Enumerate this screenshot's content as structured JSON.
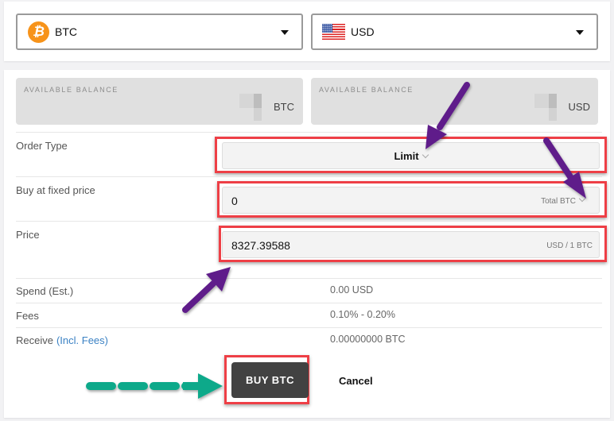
{
  "currency_selectors": {
    "crypto": {
      "label": "BTC",
      "icon": "bitcoin-icon"
    },
    "fiat": {
      "label": "USD",
      "icon": "us-flag-icon"
    }
  },
  "balances": [
    {
      "label": "AVAILABLE BALANCE",
      "currency": "BTC"
    },
    {
      "label": "AVAILABLE BALANCE",
      "currency": "USD"
    }
  ],
  "order_form": {
    "order_type": {
      "label": "Order Type",
      "value": "Limit"
    },
    "amount": {
      "label": "Buy at fixed price",
      "value": "0",
      "unit": "Total BTC"
    },
    "price": {
      "label": "Price",
      "value": "8327.39588",
      "unit": "USD / 1 BTC"
    }
  },
  "summary": {
    "spend": {
      "label": "Spend (Est.)",
      "value": "0.00 USD"
    },
    "fees": {
      "label": "Fees",
      "value": "0.10% - 0.20%"
    },
    "receive": {
      "label": "Receive",
      "link": "(Incl. Fees)",
      "value": "0.00000000 BTC"
    }
  },
  "actions": {
    "buy_label": "BUY BTC",
    "cancel_label": "Cancel"
  },
  "colors": {
    "bitcoin": "#f7931a",
    "highlight": "#ee3f46",
    "annotation_arrow": "#5e1f8a",
    "guide_arrow": "#0aa98a",
    "buy_button": "#424242",
    "link": "#3b82c4"
  }
}
